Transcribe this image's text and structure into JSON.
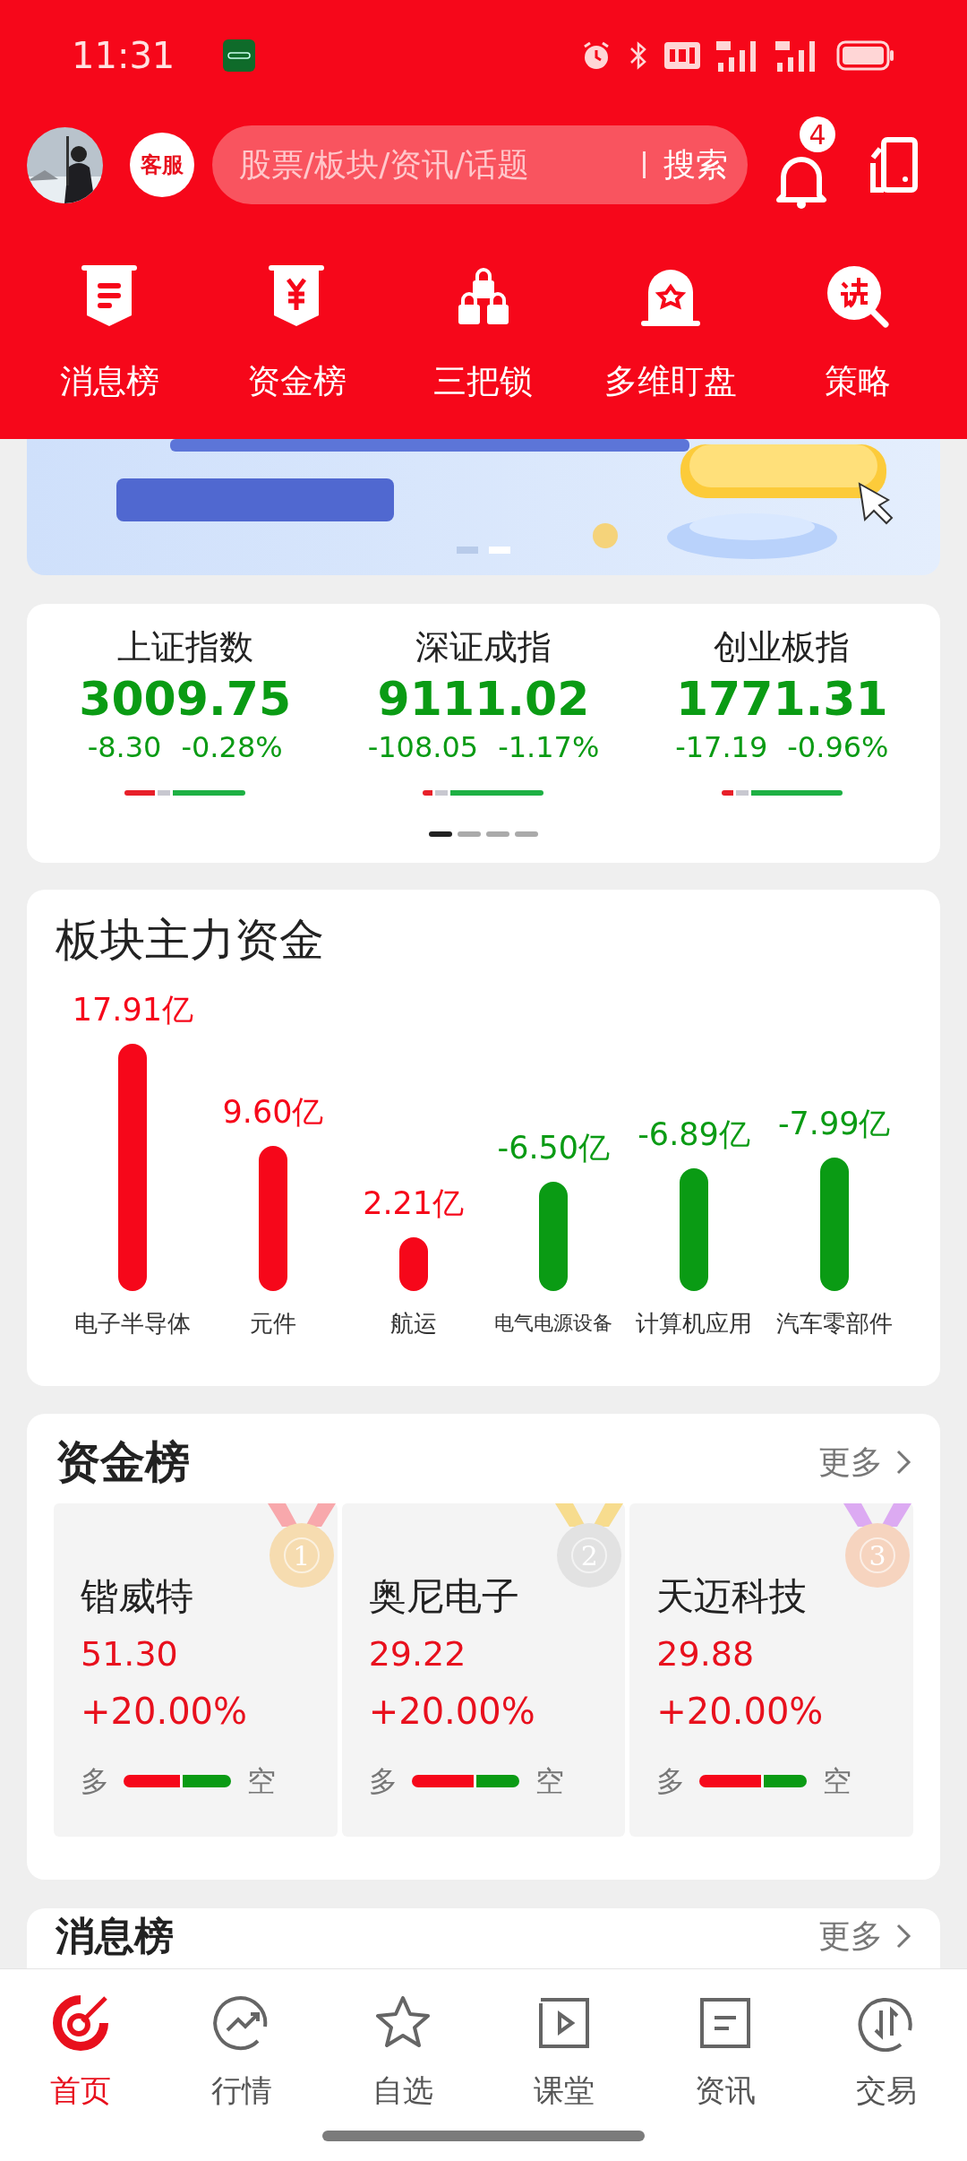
{
  "status_bar": {
    "time": "11:31"
  },
  "header": {
    "service": "客服",
    "search": {
      "placeholder": "股票/板块/资讯/话题",
      "button": "搜索"
    },
    "notification_count": "4"
  },
  "shortcuts": [
    {
      "label": "消息榜"
    },
    {
      "label": "资金榜"
    },
    {
      "label": "三把锁"
    },
    {
      "label": "多维盯盘"
    },
    {
      "label": "策略"
    }
  ],
  "banner": {
    "dots": [
      {
        "selected": false
      },
      {
        "selected": true
      }
    ]
  },
  "indices": {
    "items": [
      {
        "name": "上证指数",
        "value": "3009.75",
        "change": "-8.30",
        "percent": "-0.28%",
        "level": 0.25
      },
      {
        "name": "深证成指",
        "value": "9111.02",
        "change": "-108.05",
        "percent": "-1.17%",
        "level": 0.08
      },
      {
        "name": "创业板指",
        "value": "1771.31",
        "change": "-17.19",
        "percent": "-0.96%",
        "level": 0.1
      }
    ],
    "pages": [
      {
        "selected": true
      },
      {
        "selected": false
      },
      {
        "selected": false
      },
      {
        "selected": false
      }
    ]
  },
  "sector_funds": {
    "title": "板块主力资金",
    "sectors": [
      {
        "name": "电子半导体",
        "amount": "17.91亿",
        "color": "#f6071a"
      },
      {
        "name": "元件",
        "amount": "9.60亿",
        "color": "#f6071a"
      },
      {
        "name": "航运",
        "amount": "2.21亿",
        "color": "#f6071a"
      },
      {
        "name": "电气电源设备",
        "amount": "-6.50亿",
        "color": "#0a9b14"
      },
      {
        "name": "计算机应用",
        "amount": "-6.89亿",
        "color": "#0a9b14"
      },
      {
        "name": "汽车零部件",
        "amount": "-7.99亿",
        "color": "#0a9b14"
      }
    ]
  },
  "ranking": {
    "title": "资金榜",
    "more": "更多",
    "items": [
      {
        "rank": "1",
        "color": "#f6dcb0",
        "name": "锴威特",
        "price": "51.30",
        "change": "+20.00%",
        "long": "多",
        "short": "空",
        "level": 0.55
      },
      {
        "rank": "2",
        "color": "#e2e2e2",
        "name": "奥尼电子",
        "price": "29.22",
        "change": "+20.00%",
        "long": "多",
        "short": "空",
        "level": 0.6
      },
      {
        "rank": "3",
        "color": "#f6d4bf",
        "name": "天迈科技",
        "price": "29.88",
        "change": "+20.00%",
        "long": "多",
        "short": "空",
        "level": 0.6
      }
    ]
  },
  "news": {
    "title": "消息榜",
    "more": "更多"
  },
  "tabs": [
    {
      "label": "首页",
      "selected": true
    },
    {
      "label": "行情",
      "selected": false
    },
    {
      "label": "自选",
      "selected": false
    },
    {
      "label": "课堂",
      "selected": false
    },
    {
      "label": "资讯",
      "selected": false
    },
    {
      "label": "交易",
      "selected": false
    }
  ]
}
